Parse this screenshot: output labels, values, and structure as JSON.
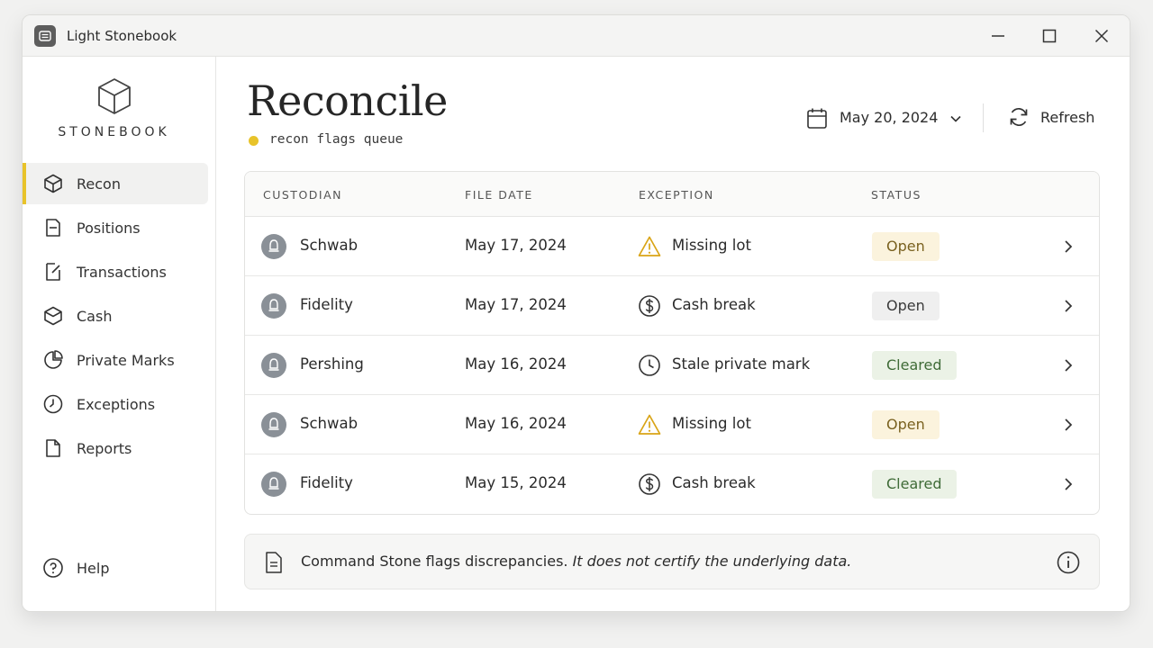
{
  "window": {
    "title": "Light Stonebook",
    "controls": [
      "minimize-icon",
      "maximize-icon",
      "close-icon"
    ]
  },
  "sidebar": {
    "logo_text": "STONEBOOK",
    "items": [
      {
        "label": "Recon",
        "icon": "cube-icon",
        "active": true
      },
      {
        "label": "Positions",
        "icon": "document-icon",
        "active": false
      },
      {
        "label": "Transactions",
        "icon": "edit-document-icon",
        "active": false
      },
      {
        "label": "Cash",
        "icon": "wallet-icon",
        "active": false
      },
      {
        "label": "Private Marks",
        "icon": "pie-chart-icon",
        "active": false
      },
      {
        "label": "Exceptions",
        "icon": "clock-icon",
        "active": false
      },
      {
        "label": "Reports",
        "icon": "file-icon",
        "active": false
      }
    ],
    "help_label": "Help"
  },
  "header": {
    "title": "Reconcile",
    "subtitle": "recon flags queue",
    "date": "May 20, 2024",
    "refresh_label": "Refresh"
  },
  "table": {
    "columns": [
      "CUSTODIAN",
      "FILE DATE",
      "EXCEPTION",
      "STATUS"
    ],
    "rows": [
      {
        "custodian": "Schwab",
        "file_date": "May 17, 2024",
        "exception": "Missing lot",
        "exception_icon": "warning-icon",
        "status": "Open"
      },
      {
        "custodian": "Fidelity",
        "file_date": "May 17, 2024",
        "exception": "Cash break",
        "exception_icon": "dollar-icon",
        "status": "Open"
      },
      {
        "custodian": "Pershing",
        "file_date": "May 16, 2024",
        "exception": "Stale private mark",
        "exception_icon": "clock-icon",
        "status": "Cleared"
      },
      {
        "custodian": "Schwab",
        "file_date": "May 16, 2024",
        "exception": "Missing lot",
        "exception_icon": "warning-icon",
        "status": "Open"
      },
      {
        "custodian": "Fidelity",
        "file_date": "May 15, 2024",
        "exception": "Cash break",
        "exception_icon": "dollar-icon",
        "status": "Cleared"
      }
    ]
  },
  "notice": {
    "text": "Command Stone flags discrepancies.",
    "emphasis": "It does not certify the underlying data."
  },
  "colors": {
    "accent": "#e8c32a",
    "open_badge_bg": "#fbf3dd",
    "cleared_badge_bg": "#ebf2e6",
    "warning": "#d9a416"
  }
}
